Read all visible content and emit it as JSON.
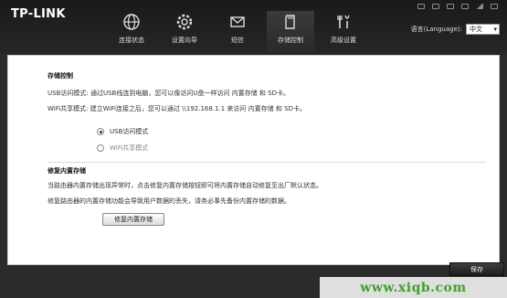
{
  "brand": {
    "logo_text": "TP-LINK"
  },
  "nav": {
    "items": [
      {
        "label": "连接状态",
        "icon": "globe-icon"
      },
      {
        "label": "设置向导",
        "icon": "gear-icon"
      },
      {
        "label": "短信",
        "icon": "mail-icon"
      },
      {
        "label": "存储控制",
        "icon": "sd-card-icon",
        "active": true
      },
      {
        "label": "高级设置",
        "icon": "tools-icon"
      }
    ]
  },
  "language": {
    "label": "语言(Language):",
    "selected": "中文"
  },
  "storage": {
    "title": "存储控制",
    "usb_desc": "USB访问模式: 通过USB线连到电脑，您可以像访问U盘一样访问 内置存储  和  SD卡。",
    "wifi_desc": "WiFi共享模式: 建立WiFi连接之后，您可以通过 \\\\192.168.1.1 来访问 内置存储  和  SD卡。",
    "options": [
      {
        "label": "USB访问模式",
        "checked": true
      },
      {
        "label": "WiFi共享模式",
        "checked": false
      }
    ]
  },
  "repair": {
    "title": "修复内置存储",
    "desc1": "当路由器内置存储出现异常时，点击修复内置存储按钮即可将内置存储自动修复至出厂默认状态。",
    "desc2": "修复路由器的内置存储功能会导致用户数据的丢失，请务必事先备份内置存储的数据。",
    "button_label": "修复内置存储"
  },
  "footer": {
    "save_label": "保存"
  },
  "watermark": {
    "text": "www.xiqb.com"
  }
}
